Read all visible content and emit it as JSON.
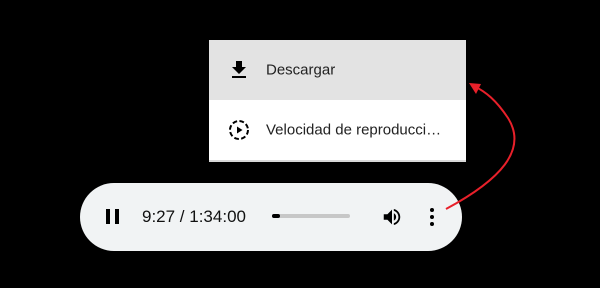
{
  "menu": {
    "items": [
      {
        "label": "Descargar",
        "icon": "download-icon"
      },
      {
        "label": "Velocidad de reproducci…",
        "icon": "playback-speed-icon"
      }
    ]
  },
  "player": {
    "time_display": "9:27 / 1:34:00",
    "progress_fraction": 0.1,
    "controls": {
      "pause_icon": "pause-icon",
      "volume_icon": "volume-icon",
      "more_icon": "more-vertical-icon"
    }
  },
  "colors": {
    "background": "#000000",
    "menu_highlight": "#e3e3e3",
    "player_background": "#f1f3f4",
    "annotation_arrow": "#e8202a"
  }
}
